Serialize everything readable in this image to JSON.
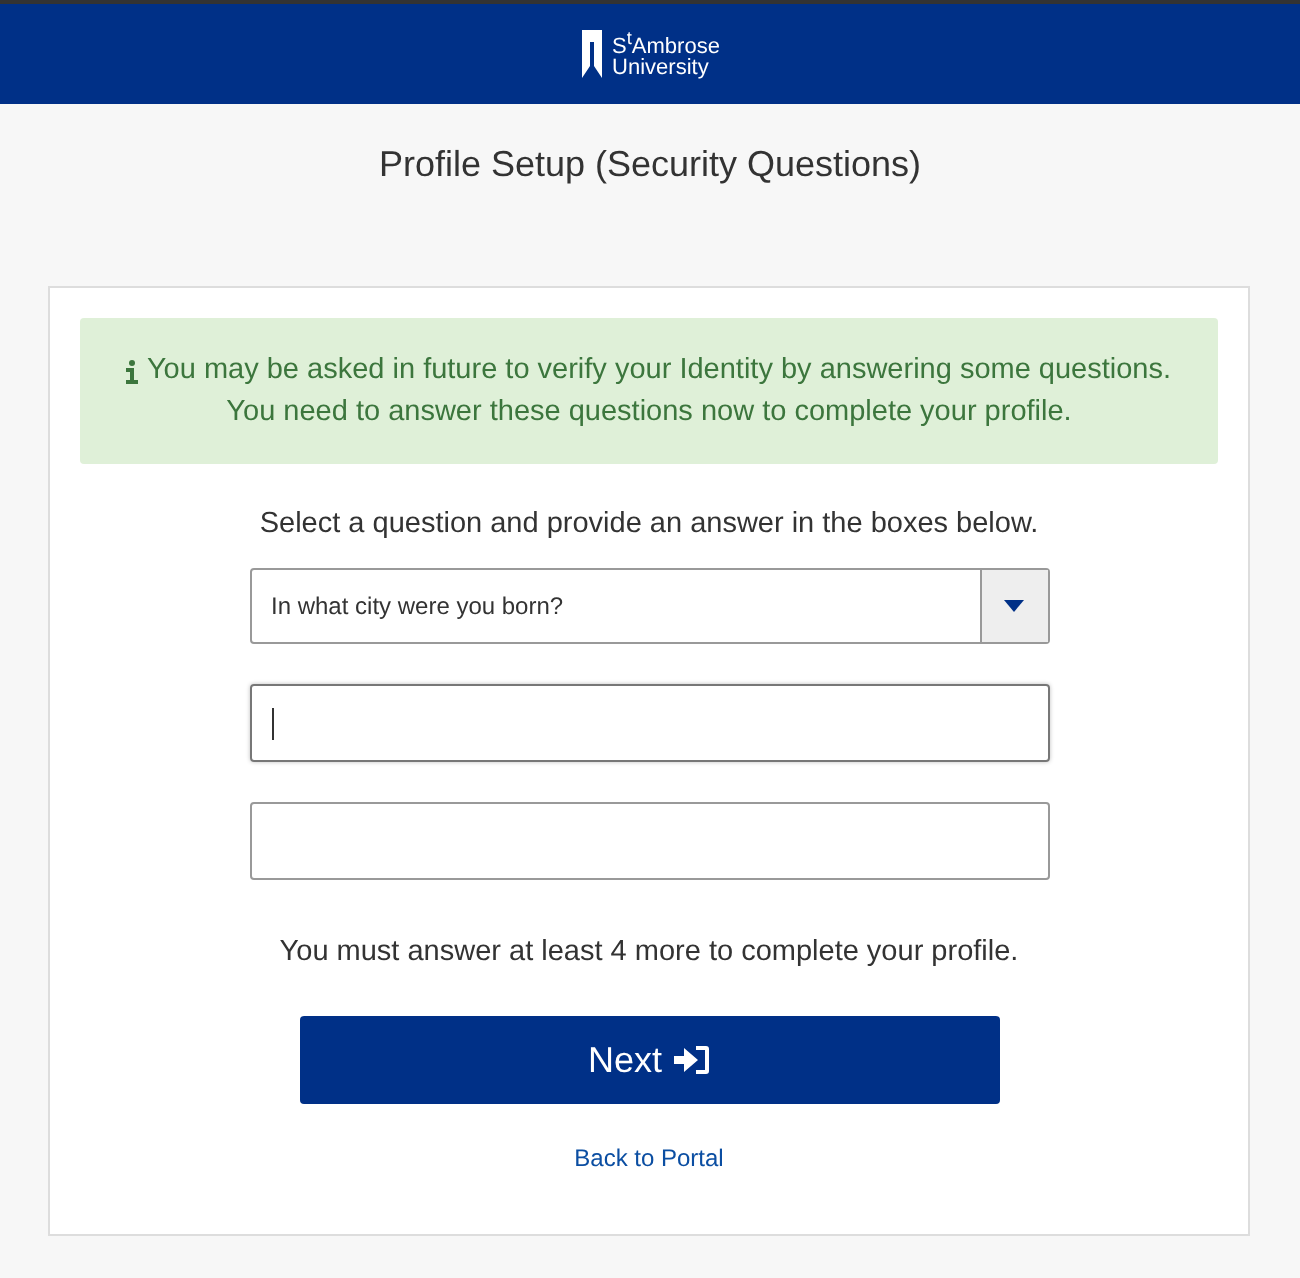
{
  "header": {
    "logo_lines": [
      "S$^{t}$Ambrose",
      "University"
    ]
  },
  "page_title": "Profile Setup (Security Questions)",
  "alert": {
    "lines": [
      "You may be asked in future to verify your Identity by answering some questions.",
      "You need to answer these questions now to complete your profile."
    ]
  },
  "instruction": "Select a question and provide an answer in the boxes below.",
  "question_select": {
    "value": "In what city were you born?"
  },
  "answer_fields": [
    {
      "focused": true
    },
    {
      "focused": false
    }
  ],
  "remaining_note": "You must answer at least 4 more to complete your profile.",
  "next_button": "Next",
  "back_link": "Back to Portal"
}
